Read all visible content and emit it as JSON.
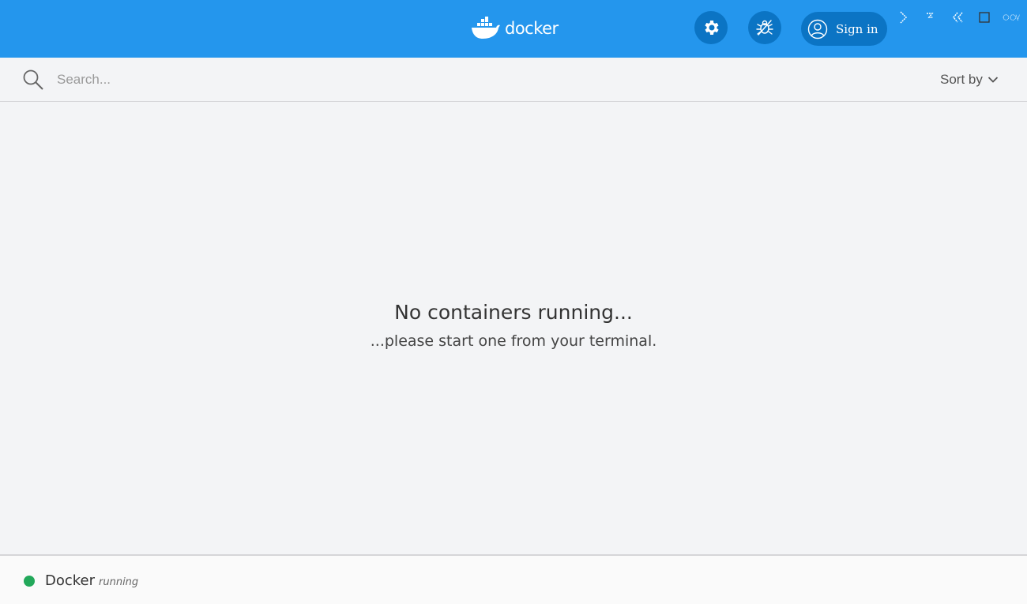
{
  "header": {
    "app_name": "docker",
    "signin_label": "Sign in"
  },
  "toolbar": {
    "search_placeholder": "Search...",
    "sort_label": "Sort by"
  },
  "main": {
    "empty_title": "No containers running...",
    "empty_subtitle": "...please start one from your terminal."
  },
  "footer": {
    "name": "Docker",
    "state": "running",
    "state_color": "#22a85a"
  },
  "colors": {
    "header_bg": "#2496ed",
    "button_bg": "#0b74c4",
    "background": "#f3f4f6"
  },
  "icons": {
    "settings": "gear-icon",
    "bug": "bug-icon",
    "user": "user-icon",
    "search": "search-icon",
    "sort": "chevron-down-icon"
  }
}
